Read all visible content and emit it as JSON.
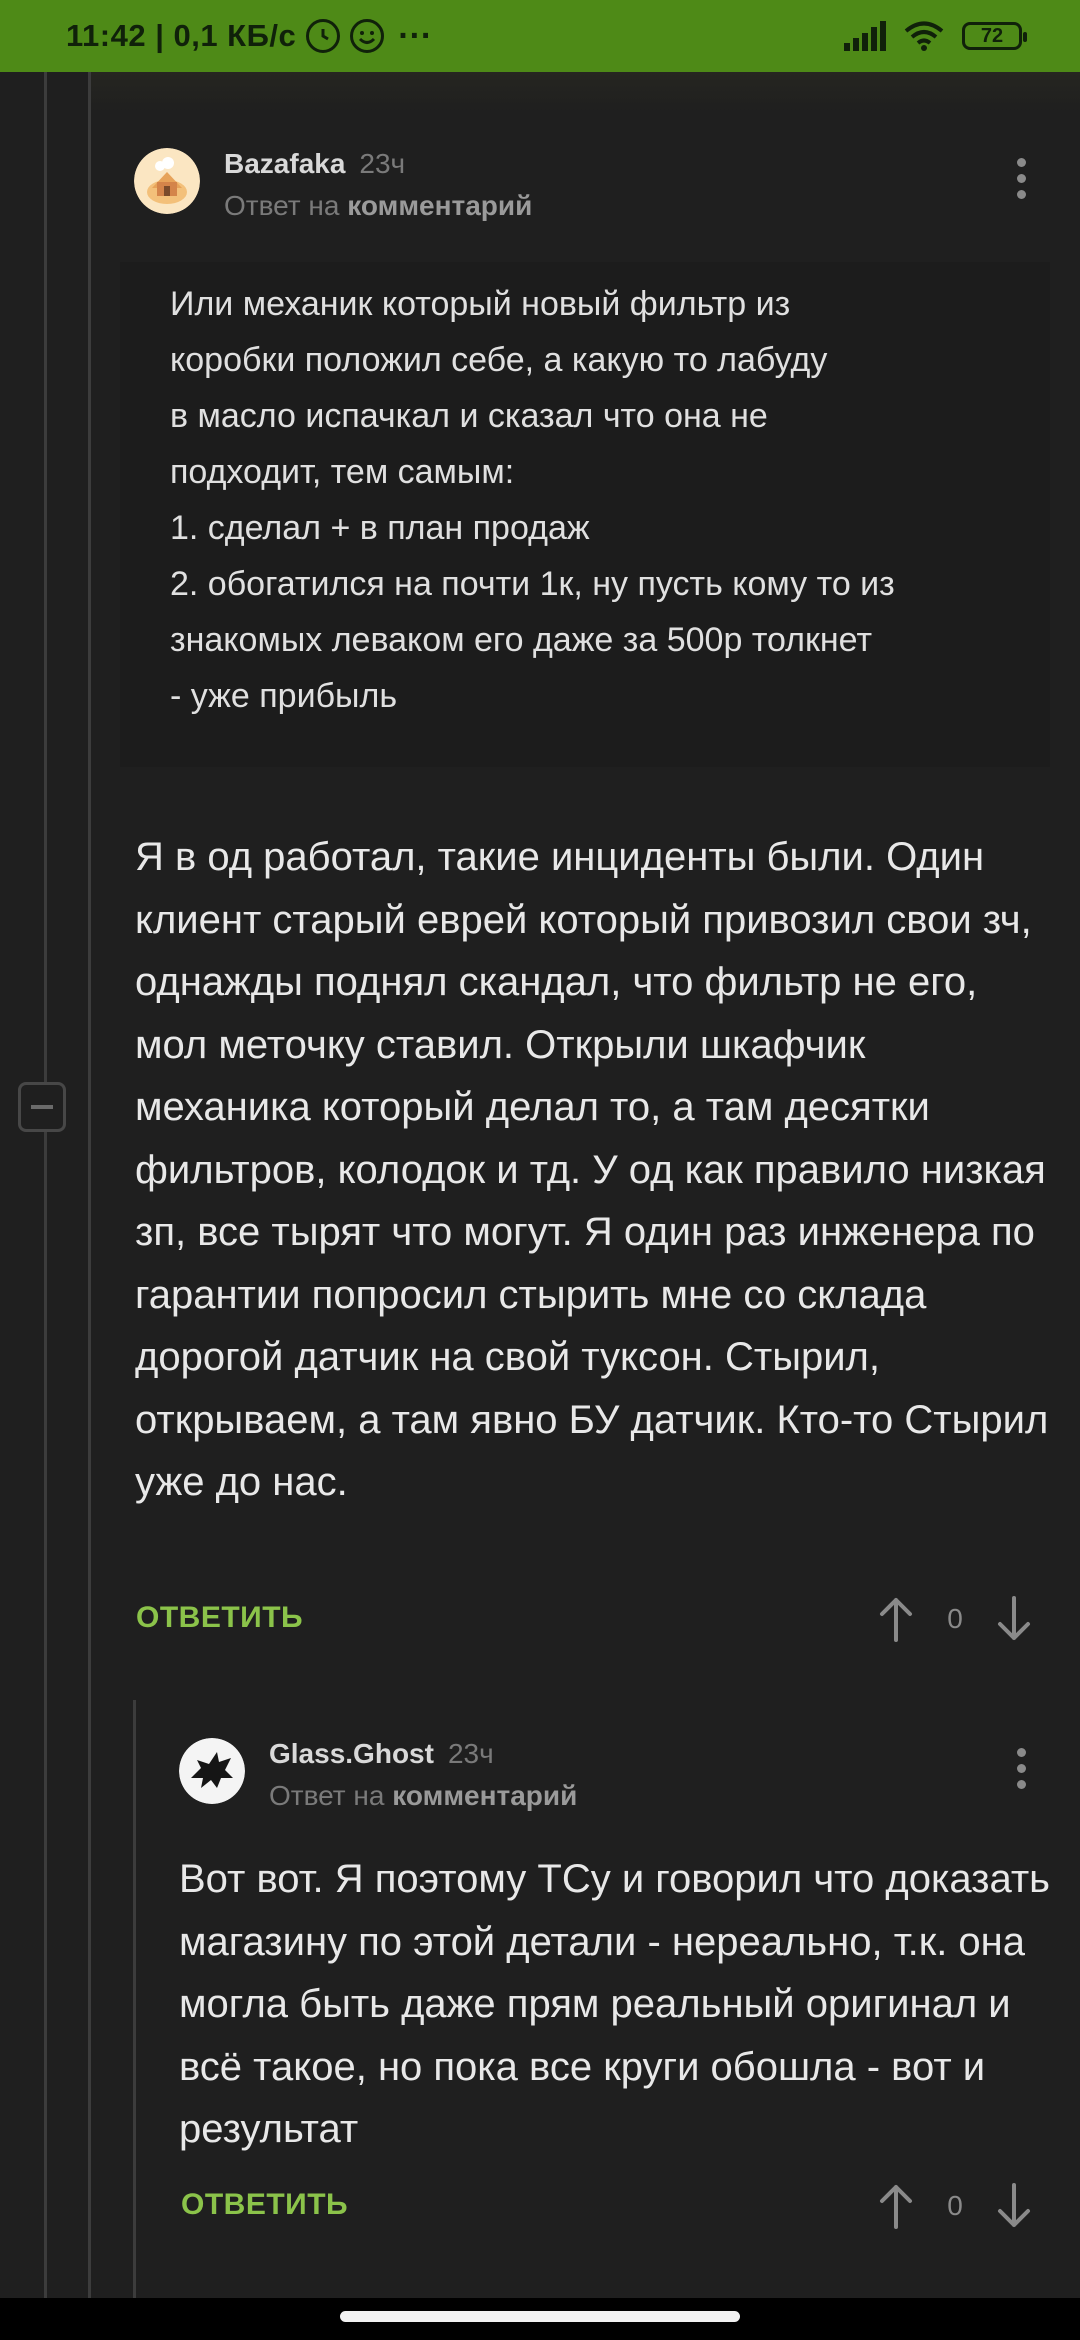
{
  "status_bar": {
    "time_speed": "11:42 | 0,1 КБ/с",
    "more": "···",
    "battery": "72",
    "icons": [
      "alarm-icon",
      "emoji-icon",
      "signal-icon",
      "wifi-icon",
      "battery-icon"
    ]
  },
  "comments": [
    {
      "author": "Bazafaka",
      "time": "23ч",
      "reply_prefix": "Ответ на",
      "reply_link": "комментарий",
      "quote": "Или механик который новый фильтр из\nкоробки положил себе, а какую то лабуду\nв масло испачкал и сказал что она не\nподходит, тем самым:\n1. сделал + в план продаж\n2. обогатился на почти 1к, ну пусть кому то из\nзнакомых леваком его даже за 500р толкнет\n- уже прибыль",
      "text": "Я в од работал, такие инциденты были. Один клиент старый еврей который привозил свои зч, однажды поднял скандал, что фильтр не его, мол меточку ставил. Открыли шкафчик механика который делал то, а там десятки фильтров, колодок и тд. У од как правило низкая зп, все тырят что могут. Я один раз инженера по гарантии попросил стырить мне со склада дорогой датчик на свой туксон. Стырил, открываем, а там явно БУ датчик. Кто-то Стырил уже до нас.",
      "reply_label": "ОТВЕТИТЬ",
      "score": "0"
    },
    {
      "author": "Glass.Ghost",
      "time": "23ч",
      "reply_prefix": "Ответ на",
      "reply_link": "комментарий",
      "text": "Вот вот. Я поэтому ТСу и говорил что доказать магазину по этой детали - нереально, т.к. она могла быть даже прям реальный оригинал и всё такое, но пока все круги обошла - вот и результат",
      "reply_label": "ОТВЕТИТЬ",
      "score": "0"
    }
  ],
  "colors": {
    "status_bar": "#4e8a17",
    "background": "#1f1f1f",
    "reply_button": "#8bc34a"
  }
}
